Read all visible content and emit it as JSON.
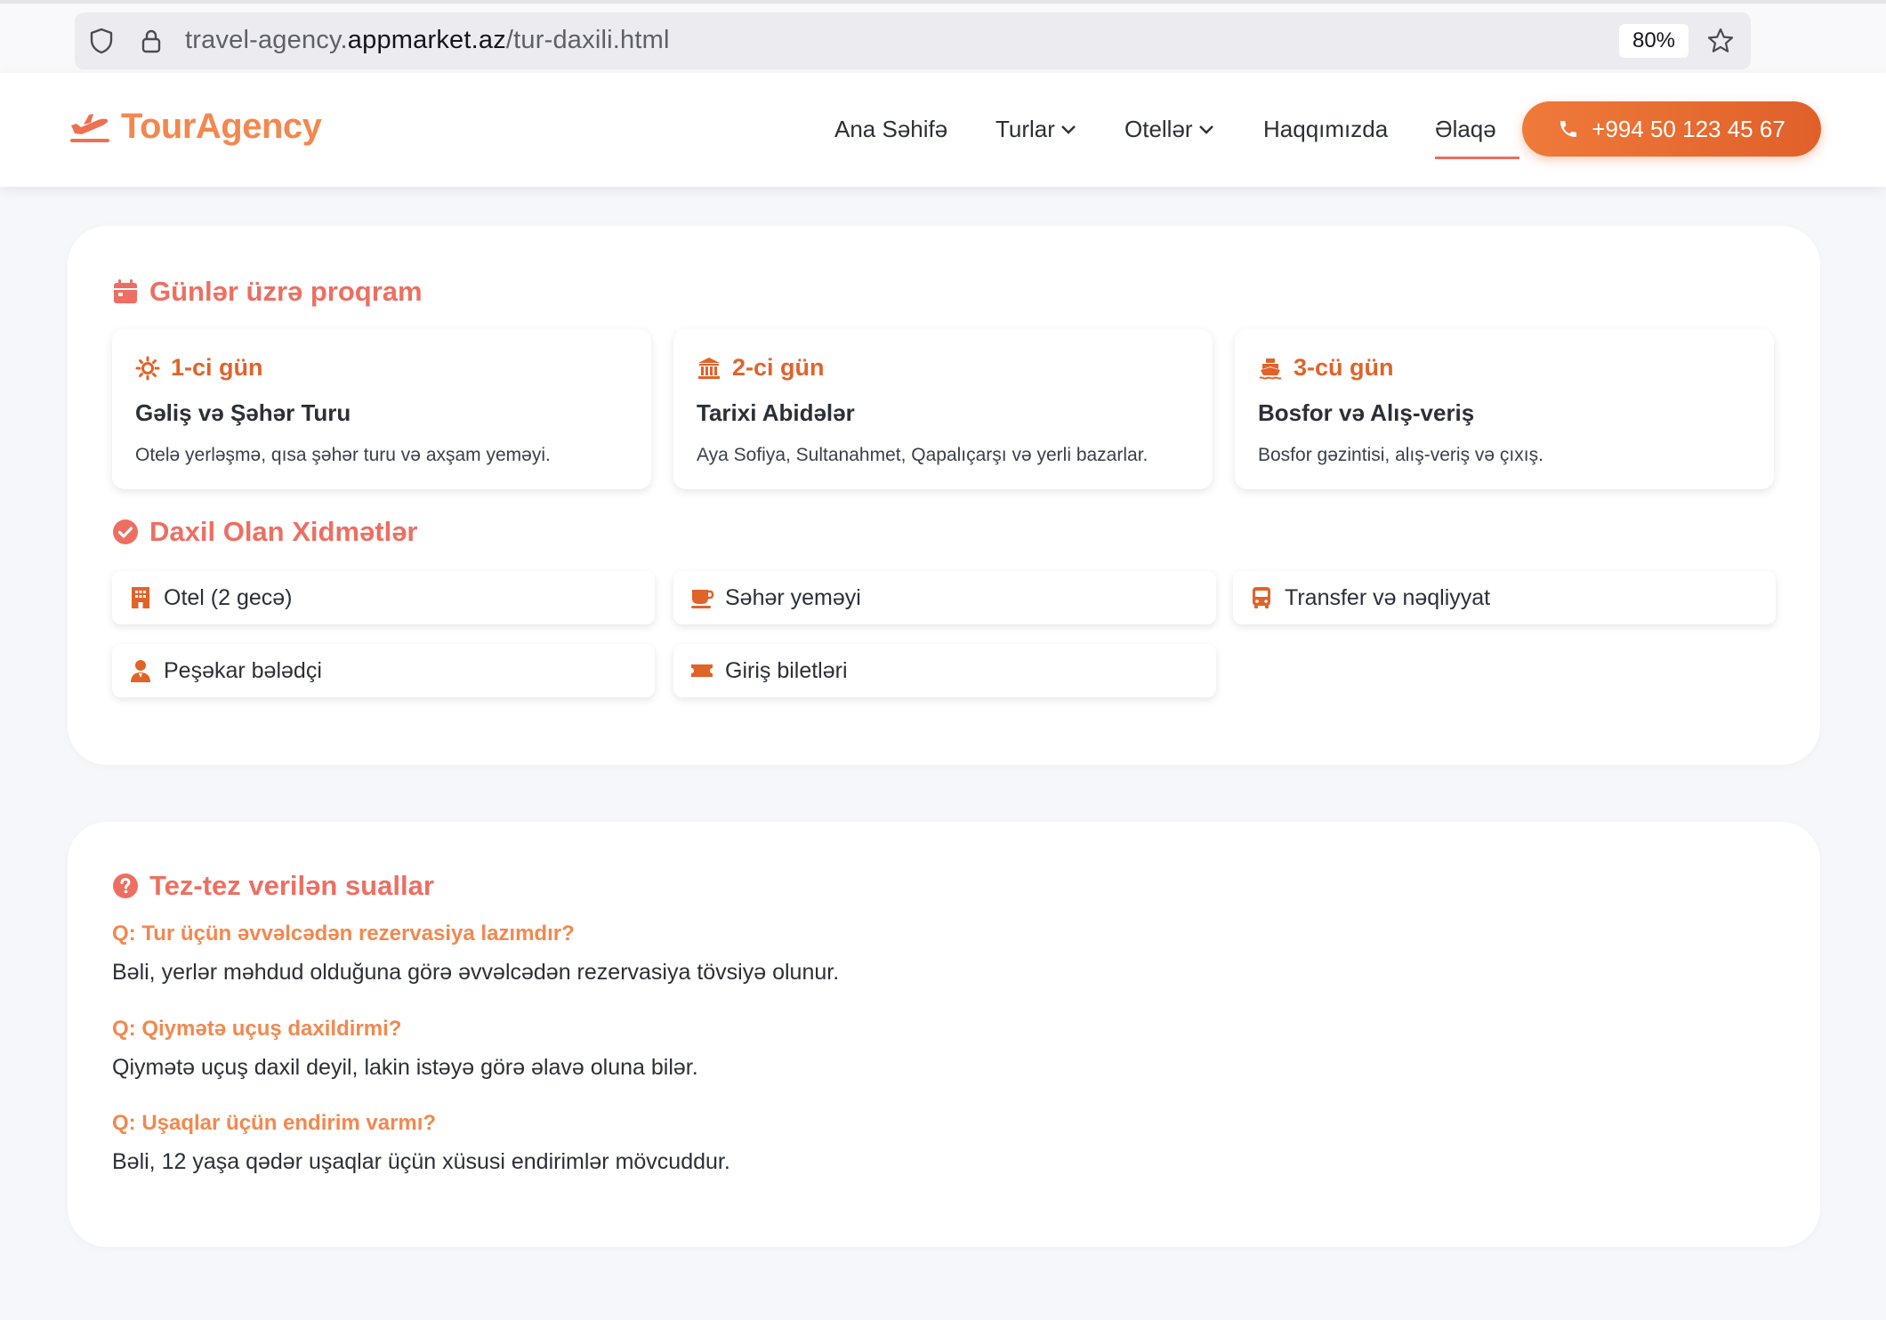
{
  "browser": {
    "url_prefix": "travel-agency.",
    "url_host": "appmarket.az",
    "url_path": "/tur-daxili.html",
    "zoom": "80%"
  },
  "header": {
    "logo_text": "TourAgency",
    "nav": [
      {
        "label": "Ana Səhifə",
        "dropdown": false,
        "active": false
      },
      {
        "label": "Turlar",
        "dropdown": true,
        "active": false
      },
      {
        "label": "Otellər",
        "dropdown": true,
        "active": false
      },
      {
        "label": "Haqqımızda",
        "dropdown": false,
        "active": false
      },
      {
        "label": "Əlaqə",
        "dropdown": false,
        "active": true
      }
    ],
    "phone": "+994 50 123 45 67"
  },
  "program": {
    "title": "Günlər üzrə proqram",
    "days": [
      {
        "day": "1-ci gün",
        "icon": "sun-icon",
        "title": "Gəliş və Şəhər Turu",
        "desc": "Otelə yerləşmə, qısa şəhər turu və axşam yeməyi."
      },
      {
        "day": "2-ci gün",
        "icon": "landmark-icon",
        "title": "Tarixi Abidələr",
        "desc": "Aya Sofiya, Sultanahmet, Qapalıçarşı və yerli bazarlar."
      },
      {
        "day": "3-cü gün",
        "icon": "ship-icon",
        "title": "Bosfor və Alış-veriş",
        "desc": "Bosfor gəzintisi, alış-veriş və çıxış."
      }
    ]
  },
  "services": {
    "title": "Daxil Olan Xidmətlər",
    "items": [
      {
        "label": "Otel (2 gecə)",
        "icon": "hotel-icon"
      },
      {
        "label": "Səhər yeməyi",
        "icon": "coffee-icon"
      },
      {
        "label": "Transfer və nəqliyyat",
        "icon": "bus-icon"
      },
      {
        "label": "Peşəkar bələdçi",
        "icon": "guide-icon"
      },
      {
        "label": "Giriş biletləri",
        "icon": "ticket-icon"
      }
    ]
  },
  "faq": {
    "title": "Tez-tez verilən suallar",
    "items": [
      {
        "q": "Q: Tur üçün əvvəlcədən rezervasiya lazımdır?",
        "a": "Bəli, yerlər məhdud olduğuna görə əvvəlcədən rezervasiya tövsiyə olunur."
      },
      {
        "q": "Q: Qiymətə uçuş daxildirmi?",
        "a": "Qiymətə uçuş daxil deyil, lakin istəyə görə əlavə oluna bilər."
      },
      {
        "q": "Q: Uşaqlar üçün endirim varmı?",
        "a": "Bəli, 12 yaşa qədər uşaqlar üçün xüsusi endirimlər mövcuddur."
      }
    ]
  },
  "colors": {
    "accent": "#f2884f",
    "section_title": "#ec6f62",
    "icon": "#e0632a",
    "button": "#e86d30"
  }
}
